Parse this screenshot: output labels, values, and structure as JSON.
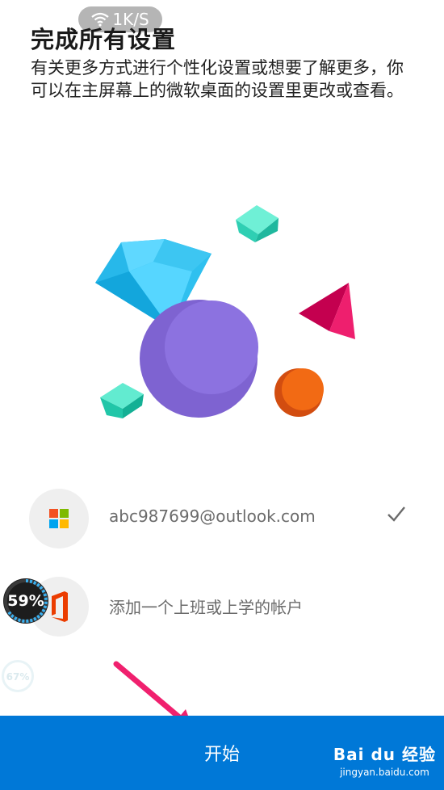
{
  "status_overlay": {
    "speed": "1K/S"
  },
  "page": {
    "title": "完成所有设置",
    "description": "有关更多方式进行个性化设置或想要了解更多，你可以在主屏幕上的微软桌面的设置里更改或查看。"
  },
  "accounts": [
    {
      "label": "abc987699@outlook.com",
      "icon": "microsoft-logo-icon",
      "checked": true
    },
    {
      "label": "添加一个上班或上学的帐户",
      "icon": "office-logo-icon",
      "checked": false
    }
  ],
  "floating_widgets": {
    "memory_percent": "59%",
    "secondary_percent": "67%"
  },
  "footer": {
    "start_label": "开始",
    "brand_color": "#0078d7"
  },
  "watermark": {
    "brand": "Bai du 经验",
    "url": "jingyan.baidu.com"
  }
}
